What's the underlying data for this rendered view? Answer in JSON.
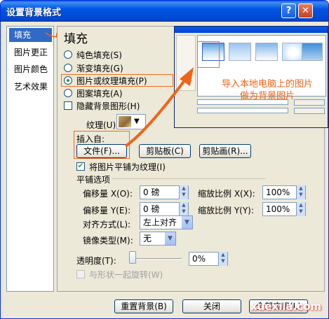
{
  "window": {
    "title": "设置背景格式",
    "help_label": "?",
    "close_label": "✕"
  },
  "sidebar": {
    "items": [
      {
        "label": "填充",
        "selected": true
      },
      {
        "label": "图片更正",
        "selected": false
      },
      {
        "label": "图片颜色",
        "selected": false
      },
      {
        "label": "艺术效果",
        "selected": false
      }
    ]
  },
  "fill": {
    "title": "填充",
    "options": [
      {
        "label": "纯色填充(S)",
        "checked": false
      },
      {
        "label": "渐变填充(G)",
        "checked": false
      },
      {
        "label": "图片或纹理填充(P)",
        "checked": true
      },
      {
        "label": "图案填充(A)",
        "checked": false
      }
    ],
    "hide_bg_label": "隐藏背景图形(H)",
    "texture_label": "纹理(U):",
    "insert_from_label": "插入自:",
    "file_button": "文件(F)...",
    "clipboard_button": "剪贴板(C)",
    "clipart_button": "剪贴画(R)...",
    "tile_label": "将图片平铺为纹理(I)",
    "tile_options_label": "平铺选项",
    "offset_x_label": "偏移量 X(O):",
    "offset_x_value": "0 磅",
    "offset_y_label": "偏移量 Y(E):",
    "offset_y_value": "0 磅",
    "scale_x_label": "缩放比例 X(X):",
    "scale_x_value": "100%",
    "scale_y_label": "缩放比例 Y(Y):",
    "scale_y_value": "100%",
    "align_label": "对齐方式(L):",
    "align_value": "左上对齐",
    "mirror_label": "镜像类型(M):",
    "mirror_value": "无",
    "transparency_label": "透明度(T):",
    "transparency_value": "0%",
    "transparency_level": 0,
    "rotate_label": "与形状一起旋转(W)"
  },
  "footer": {
    "reset_button": "重置背景(B)",
    "close_button": "关闭",
    "apply_all_button": "全部应用(L)"
  },
  "annotation": {
    "line1": "导入本地电脑上的图片",
    "line2": "做为背景图片"
  },
  "watermark": "xuexila.com",
  "colors": {
    "title_bar": "#0054e3",
    "selection": "#316ac5",
    "annotation": "#f06418",
    "dialog_bg": "#ece9d8"
  }
}
